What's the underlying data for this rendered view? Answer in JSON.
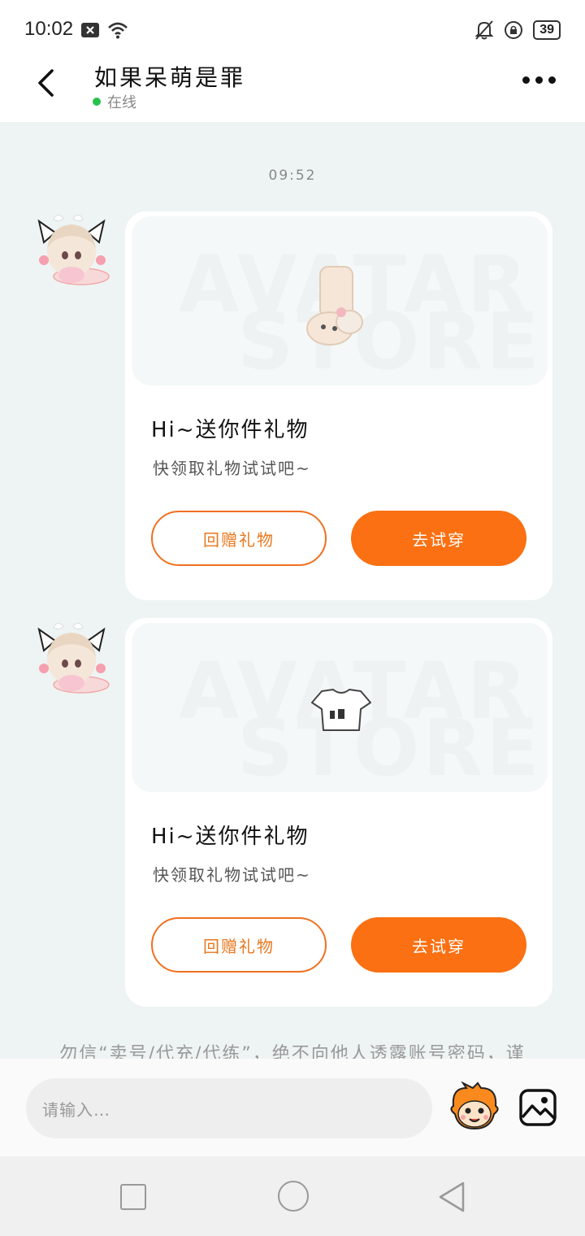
{
  "status_bar": {
    "time": "10:02",
    "battery": "39",
    "icons": [
      "close-notification-icon",
      "wifi-icon",
      "mute-bell-icon",
      "rotation-lock-icon",
      "battery-icon"
    ]
  },
  "header": {
    "title": "如果呆萌是罪",
    "status": "在线"
  },
  "chat": {
    "timestamp": "09:52",
    "messages": [
      {
        "title": "Hi~送你件礼物",
        "subtitle": "快领取礼物试试吧~",
        "return_label": "回赠礼物",
        "try_label": "去试穿",
        "watermark_top": "AVATAR",
        "watermark_bottom": "STORE",
        "item": "socks"
      },
      {
        "title": "Hi~送你件礼物",
        "subtitle": "快领取礼物试试吧~",
        "return_label": "回赠礼物",
        "try_label": "去试穿",
        "watermark_top": "AVATAR",
        "watermark_bottom": "STORE",
        "item": "crop-top"
      }
    ],
    "notice": "勿信“卖号/代充/代练”，绝不向他人透露账号密码，谨"
  },
  "input_bar": {
    "placeholder": "请输入…"
  },
  "colors": {
    "accent": "#fa7012",
    "online": "#27c24c",
    "background": "#eef4f4"
  }
}
